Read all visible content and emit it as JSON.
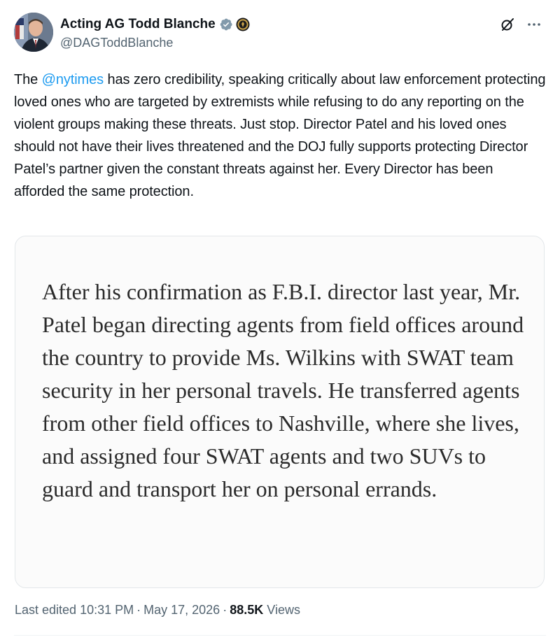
{
  "author": {
    "display_name": "Acting AG Todd Blanche",
    "handle": "@DAGToddBlanche",
    "verified": true
  },
  "tweet": {
    "text_before_mention": "The ",
    "mention": "@nytimes",
    "text_after_mention": " has zero credibility, speaking critically about law enforcement protecting loved ones who are targeted by extremists while refusing to do any reporting on the violent groups making these threats. Just stop. Director Patel and his loved ones should not have their lives threatened and the DOJ fully supports protecting Director Patel’s partner given the constant threats against her. Every Director has been afforded the same protection."
  },
  "quote_image": {
    "text": "After his confirmation as F.B.I. director last year, Mr. Patel began directing agents from field offices around the country to provide Ms. Wilkins with SWAT team security in her personal travels. He transferred agents from other field offices to Nashville, where she lives, and assigned four SWAT agents and two SUVs to guard and transport her on personal errands."
  },
  "meta": {
    "edited_label": "Last edited 10:31 PM",
    "separator": "·",
    "date": "May 17, 2026",
    "views_count": "88.5K",
    "views_label": "Views"
  },
  "colors": {
    "accent": "#1d9bf0",
    "verified": "#829aab",
    "text": "#0f1419",
    "secondary": "#536471"
  },
  "icons": {
    "verified": "verified-badge-icon",
    "seal": "doj-seal-icon",
    "grok": "grok-icon",
    "more": "more-icon"
  }
}
